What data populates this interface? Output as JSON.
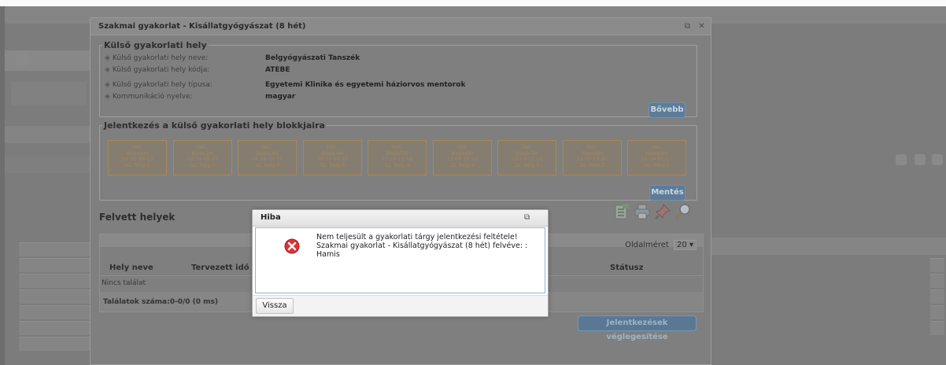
{
  "window": {
    "title": "Szakmai gyakorlat - Kisállatgyógyászat (8 hét)",
    "restore_icon": "restore-icon",
    "close_icon": "close-icon"
  },
  "external_site": {
    "legend": "Külső gyakorlati hely",
    "rows": [
      {
        "label": "Külső gyakorlati hely neve:",
        "value": "Belgyógyászati Tanszék"
      },
      {
        "label": "Külső gyakorlati hely kódja:",
        "value": "ATEBE"
      },
      {
        "label": "Külső gyakorlati hely típusa:",
        "value": "Egyetemi Klinika és egyetemi háziorvos mentorok"
      },
      {
        "label": "Kommunikáció nyelve:",
        "value": "magyar"
      }
    ],
    "more_button": "Bővebb"
  },
  "blocks": {
    "legend": "Jelentkezés a külső gyakorlati hely blokkjaira",
    "tiles": [
      {
        "line1": "Hét:",
        "line2": "Blokk1M",
        "line3": "08.31-09.13",
        "line4": "Sz. hely:3"
      },
      {
        "line1": "Hét:",
        "line2": "Blokk2M",
        "line3": "09.14-09.27",
        "line4": "Sz. hely:3"
      },
      {
        "line1": "Hét:",
        "line2": "Blokk3M",
        "line3": "09.28-10.11",
        "line4": "Sz. hely:3"
      },
      {
        "line1": "Hét:",
        "line2": "Blokk4M",
        "line3": "10.12-10.25",
        "line4": "Sz. hely:3"
      },
      {
        "line1": "Hét:",
        "line2": "Blokk5M",
        "line3": "10.26-11.08",
        "line4": "Sz. hely:3"
      },
      {
        "line1": "Hét:",
        "line2": "Blokk6M",
        "line3": "11.09-11.22",
        "line4": "Sz. hely:3"
      },
      {
        "line1": "Hét:",
        "line2": "Blokk7M",
        "line3": "11.23-12.06",
        "line4": "Sz. hely:3"
      },
      {
        "line1": "Hét:",
        "line2": "Blokk8M",
        "line3": "12.07-12.20",
        "line4": "Sz. hely:3"
      },
      {
        "line1": "Hét:",
        "line2": "Blokk9M",
        "line3": "01.04-01.17",
        "line4": "Sz. hely:3"
      }
    ],
    "save_button": "Mentés"
  },
  "taken": {
    "title": "Felvett helyek",
    "toolbar_icons": [
      "export-icon",
      "print-icon",
      "pin-icon",
      "search-icon"
    ],
    "page_size_label": "Oldalméret",
    "page_size_value": "20",
    "columns": [
      "Hely neve",
      "Tervezett idő int",
      "Státusz"
    ],
    "empty_text": "Nincs találat",
    "footer_text": "Találatok száma:0-0/0 (0 ms)",
    "finalize_button": "Jelentkezések véglegesítése"
  },
  "error_dialog": {
    "title": "Hiba",
    "icon": "error-icon",
    "message_line1": "Nem teljesült a gyakorlati tárgy jelentkezési feltétele!",
    "message_line2": "Szakmai gyakorlat - Kisállatgyógyászat (8 hét) felvéve: :",
    "message_line3": "Hamis",
    "back_button": "Vissza"
  }
}
